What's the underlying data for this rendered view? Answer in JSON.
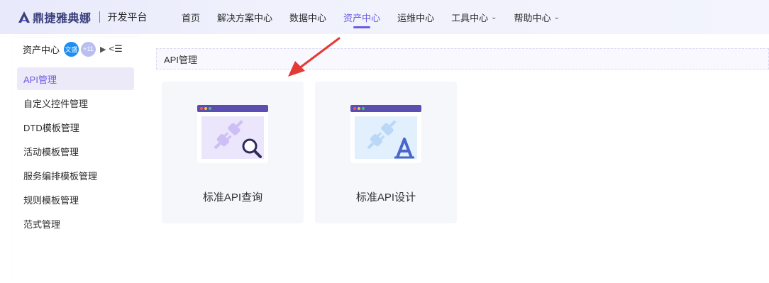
{
  "header": {
    "brand_name": "鼎捷雅典娜",
    "brand_sub": "开发平台",
    "nav": [
      {
        "label": "首页",
        "dropdown": false,
        "active": false
      },
      {
        "label": "解决方案中心",
        "dropdown": false,
        "active": false
      },
      {
        "label": "数据中心",
        "dropdown": false,
        "active": false
      },
      {
        "label": "资产中心",
        "dropdown": false,
        "active": true
      },
      {
        "label": "运维中心",
        "dropdown": false,
        "active": false
      },
      {
        "label": "工具中心",
        "dropdown": true,
        "active": false
      },
      {
        "label": "帮助中心",
        "dropdown": true,
        "active": false
      }
    ]
  },
  "sidebar": {
    "title": "资产中心",
    "avatar_text": "文盛",
    "more_count": "+11",
    "items": [
      {
        "label": "API管理",
        "active": true
      },
      {
        "label": "自定义控件管理",
        "active": false
      },
      {
        "label": "DTD模板管理",
        "active": false
      },
      {
        "label": "活动模板管理",
        "active": false
      },
      {
        "label": "服务编排模板管理",
        "active": false
      },
      {
        "label": "规则模板管理",
        "active": false
      },
      {
        "label": "范式管理",
        "active": false
      }
    ]
  },
  "main": {
    "breadcrumb": "API管理",
    "cards": [
      {
        "label": "标准API查询",
        "icon": "plug-search-icon"
      },
      {
        "label": "标准API设计",
        "icon": "plug-design-icon"
      }
    ]
  },
  "colors": {
    "accent": "#6b5be6",
    "header_bg": "#eef0fc",
    "card_bg": "#f6f7fb",
    "arrow": "#e53935"
  }
}
